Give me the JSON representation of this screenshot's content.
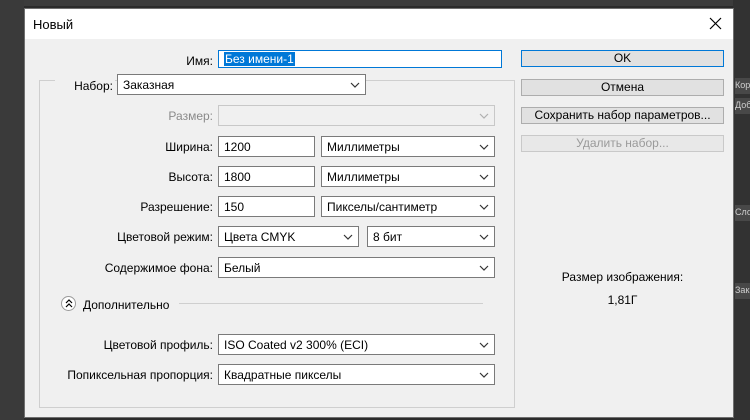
{
  "dialog": {
    "title": "Новый",
    "name_label": "Имя:",
    "name_value": "Без имени-1",
    "preset_label": "Набор:",
    "preset_value": "Заказная",
    "size_label": "Размер:",
    "size_value": "",
    "width_label": "Ширина:",
    "width_value": "1200",
    "width_unit": "Миллиметры",
    "height_label": "Высота:",
    "height_value": "1800",
    "height_unit": "Миллиметры",
    "resolution_label": "Разрешение:",
    "resolution_value": "150",
    "resolution_unit": "Пикселы/сантиметр",
    "color_mode_label": "Цветовой режим:",
    "color_mode_value": "Цвета CMYK",
    "bit_depth_value": "8 бит",
    "background_label": "Содержимое фона:",
    "background_value": "Белый",
    "advanced_label": "Дополнительно",
    "color_profile_label": "Цветовой профиль:",
    "color_profile_value": "ISO Coated v2 300% (ECI)",
    "pixel_aspect_label": "Попиксельная пропорция:",
    "pixel_aspect_value": "Квадратные пикселы"
  },
  "buttons": {
    "ok": "OK",
    "cancel": "Отмена",
    "save_preset": "Сохранить набор параметров...",
    "delete_preset": "Удалить набор..."
  },
  "image_size": {
    "label": "Размер изображения:",
    "value": "1,81Г"
  },
  "host_panel": {
    "items": [
      "Кор",
      "Доб",
      "Сло",
      "Закр"
    ]
  },
  "colors": {
    "accent": "#0078d7",
    "dialog_bg": "#f0f0f0",
    "host_bg": "#2b2b2b"
  }
}
